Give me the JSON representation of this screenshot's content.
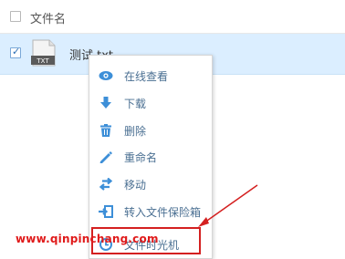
{
  "header": {
    "column_label": "文件名"
  },
  "file": {
    "name": "测试.txt",
    "type_badge": "TXT",
    "checked": true
  },
  "context_menu": {
    "items": [
      {
        "label": "在线查看",
        "icon": "eye-icon"
      },
      {
        "label": "下载",
        "icon": "download-icon"
      },
      {
        "label": "删除",
        "icon": "trash-icon"
      },
      {
        "label": "重命名",
        "icon": "pencil-icon"
      },
      {
        "label": "移动",
        "icon": "move-arrows-icon"
      },
      {
        "label": "转入文件保险箱",
        "icon": "safe-import-icon"
      },
      {
        "label": "文件时光机",
        "icon": "time-machine-icon"
      }
    ]
  },
  "annotation": {
    "watermark": "www.qinpinchang.com",
    "highlight_color": "#d42020"
  },
  "colors": {
    "selected_row_bg": "#dbeeff",
    "menu_icon": "#3d8fd8",
    "menu_text": "#4a6f92"
  }
}
